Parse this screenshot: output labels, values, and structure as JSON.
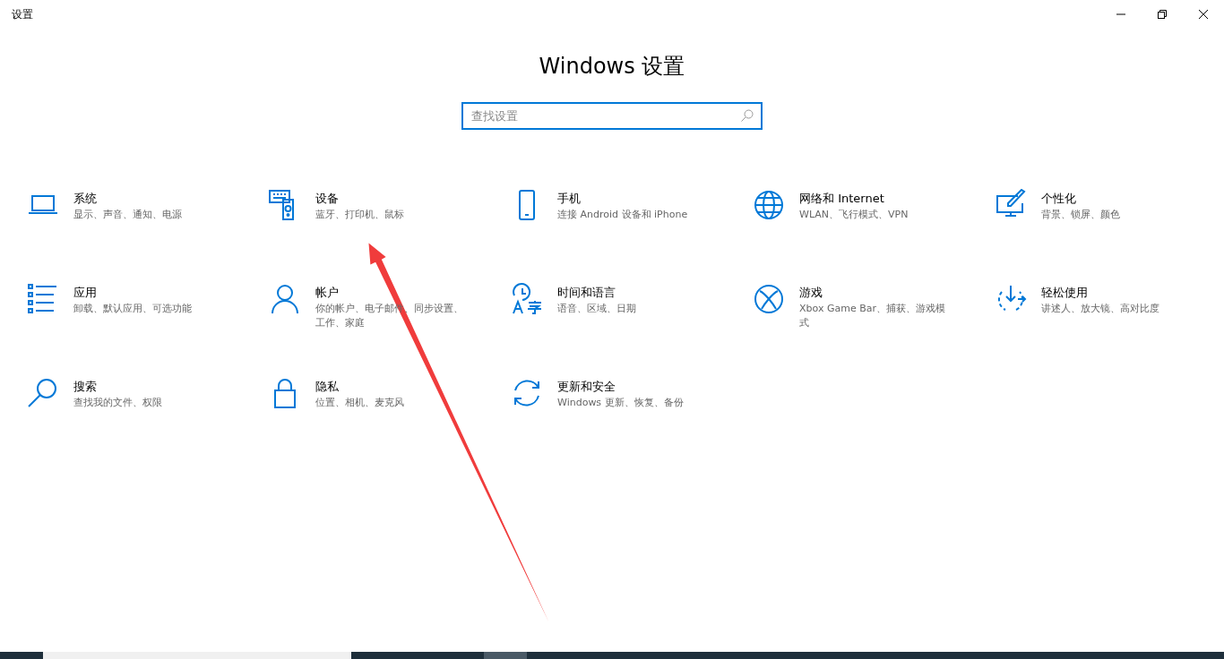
{
  "window": {
    "title": "设置"
  },
  "heading": "Windows 设置",
  "search": {
    "placeholder": "查找设置"
  },
  "categories": [
    {
      "kind": "system",
      "title": "系统",
      "desc": "显示、声音、通知、电源"
    },
    {
      "kind": "devices",
      "title": "设备",
      "desc": "蓝牙、打印机、鼠标"
    },
    {
      "kind": "phone",
      "title": "手机",
      "desc": "连接 Android 设备和 iPhone"
    },
    {
      "kind": "network",
      "title": "网络和 Internet",
      "desc": "WLAN、飞行模式、VPN"
    },
    {
      "kind": "personalization",
      "title": "个性化",
      "desc": "背景、锁屏、颜色"
    },
    {
      "kind": "apps",
      "title": "应用",
      "desc": "卸载、默认应用、可选功能"
    },
    {
      "kind": "accounts",
      "title": "帐户",
      "desc": "你的帐户、电子邮件、同步设置、工作、家庭"
    },
    {
      "kind": "time",
      "title": "时间和语言",
      "desc": "语音、区域、日期"
    },
    {
      "kind": "gaming",
      "title": "游戏",
      "desc": "Xbox Game Bar、捕获、游戏模式"
    },
    {
      "kind": "ease",
      "title": "轻松使用",
      "desc": "讲述人、放大镜、高对比度"
    },
    {
      "kind": "search",
      "title": "搜索",
      "desc": "查找我的文件、权限"
    },
    {
      "kind": "privacy",
      "title": "隐私",
      "desc": "位置、相机、麦克风"
    },
    {
      "kind": "update",
      "title": "更新和安全",
      "desc": "Windows 更新、恢复、备份"
    }
  ]
}
